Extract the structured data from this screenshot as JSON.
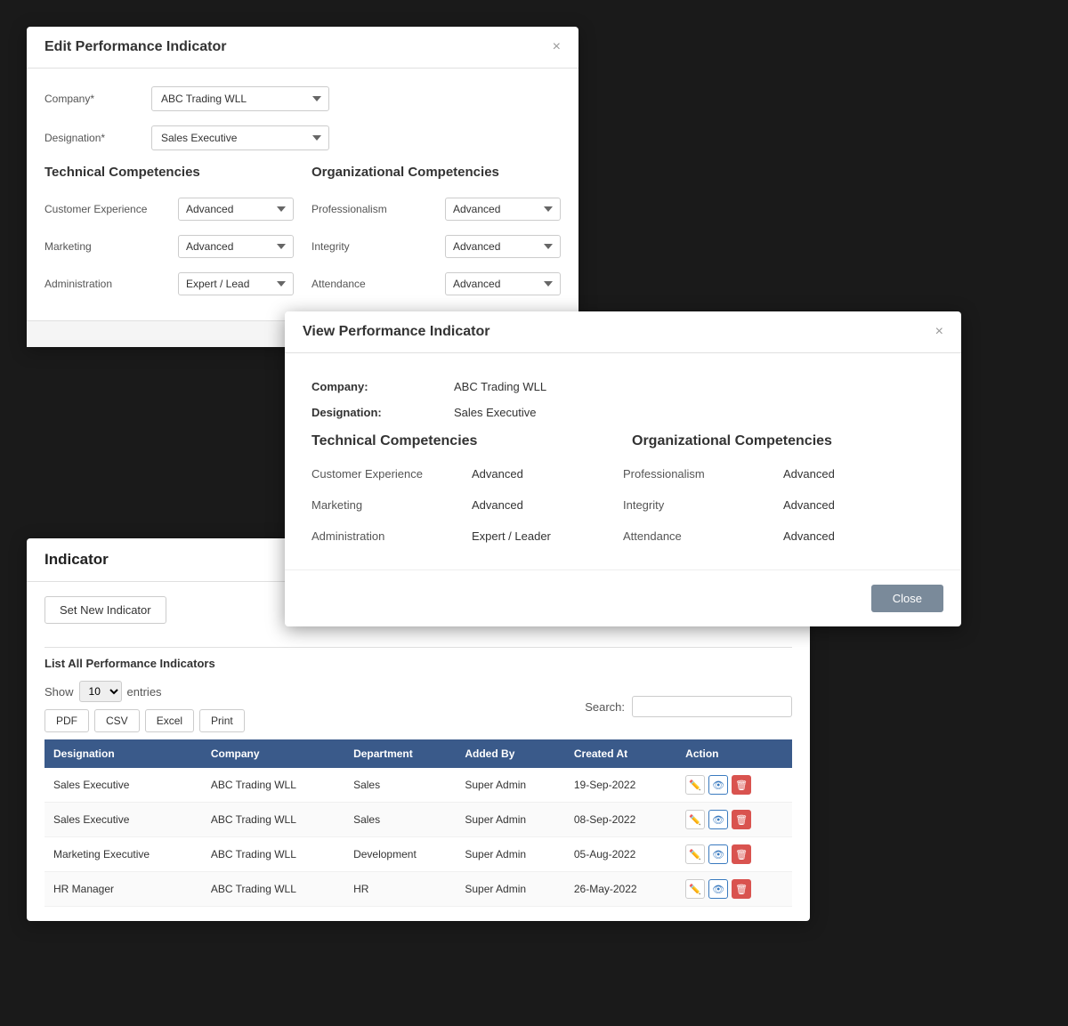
{
  "edit_modal": {
    "title": "Edit Performance Indicator",
    "close_label": "×",
    "company_label": "Company*",
    "company_value": "ABC Trading WLL",
    "designation_label": "Designation*",
    "designation_value": "Sales Executive",
    "technical_title": "Technical Competencies",
    "organizational_title": "Organizational Competencies",
    "technical_competencies": [
      {
        "label": "Customer Experience",
        "value": "Advanced"
      },
      {
        "label": "Marketing",
        "value": "Advanced"
      },
      {
        "label": "Administration",
        "value": "Expert / Lead"
      }
    ],
    "organizational_competencies": [
      {
        "label": "Professionalism",
        "value": "Advanced"
      },
      {
        "label": "Integrity",
        "value": "Advanced"
      },
      {
        "label": "Attendance",
        "value": "Advanced"
      }
    ]
  },
  "view_modal": {
    "title": "View Performance Indicator",
    "close_label": "×",
    "company_label": "Company:",
    "company_value": "ABC Trading WLL",
    "designation_label": "Designation:",
    "designation_value": "Sales Executive",
    "technical_title": "Technical Competencies",
    "organizational_title": "Organizational Competencies",
    "technical_competencies": [
      {
        "label": "Customer Experience",
        "value": "Advanced"
      },
      {
        "label": "Marketing",
        "value": "Advanced"
      },
      {
        "label": "Administration",
        "value": "Expert / Leader"
      }
    ],
    "organizational_competencies": [
      {
        "label": "Professionalism",
        "value": "Advanced"
      },
      {
        "label": "Integrity",
        "value": "Advanced"
      },
      {
        "label": "Attendance",
        "value": "Advanced"
      }
    ],
    "close_btn_label": "Close"
  },
  "indicator_panel": {
    "title": "Indicator",
    "set_new_label": "Set New Indicator",
    "list_all_text": "List All",
    "list_all_highlight": "Performance Indicators",
    "show_label": "Show",
    "show_value": "10",
    "entries_label": "entries",
    "export_buttons": [
      "PDF",
      "CSV",
      "Excel",
      "Print"
    ],
    "search_label": "Search:",
    "search_placeholder": "",
    "table_headers": [
      "Designation",
      "Company",
      "Department",
      "Added By",
      "Created At",
      "Action"
    ],
    "table_rows": [
      {
        "designation": "Sales Executive",
        "company": "ABC Trading WLL",
        "department": "Sales",
        "added_by": "Super Admin",
        "created_at": "19-Sep-2022"
      },
      {
        "designation": "Sales Executive",
        "company": "ABC Trading WLL",
        "department": "Sales",
        "added_by": "Super Admin",
        "created_at": "08-Sep-2022"
      },
      {
        "designation": "Marketing Executive",
        "company": "ABC Trading WLL",
        "department": "Development",
        "added_by": "Super Admin",
        "created_at": "05-Aug-2022"
      },
      {
        "designation": "HR Manager",
        "company": "ABC Trading WLL",
        "department": "HR",
        "added_by": "Super Admin",
        "created_at": "26-May-2022"
      }
    ]
  }
}
